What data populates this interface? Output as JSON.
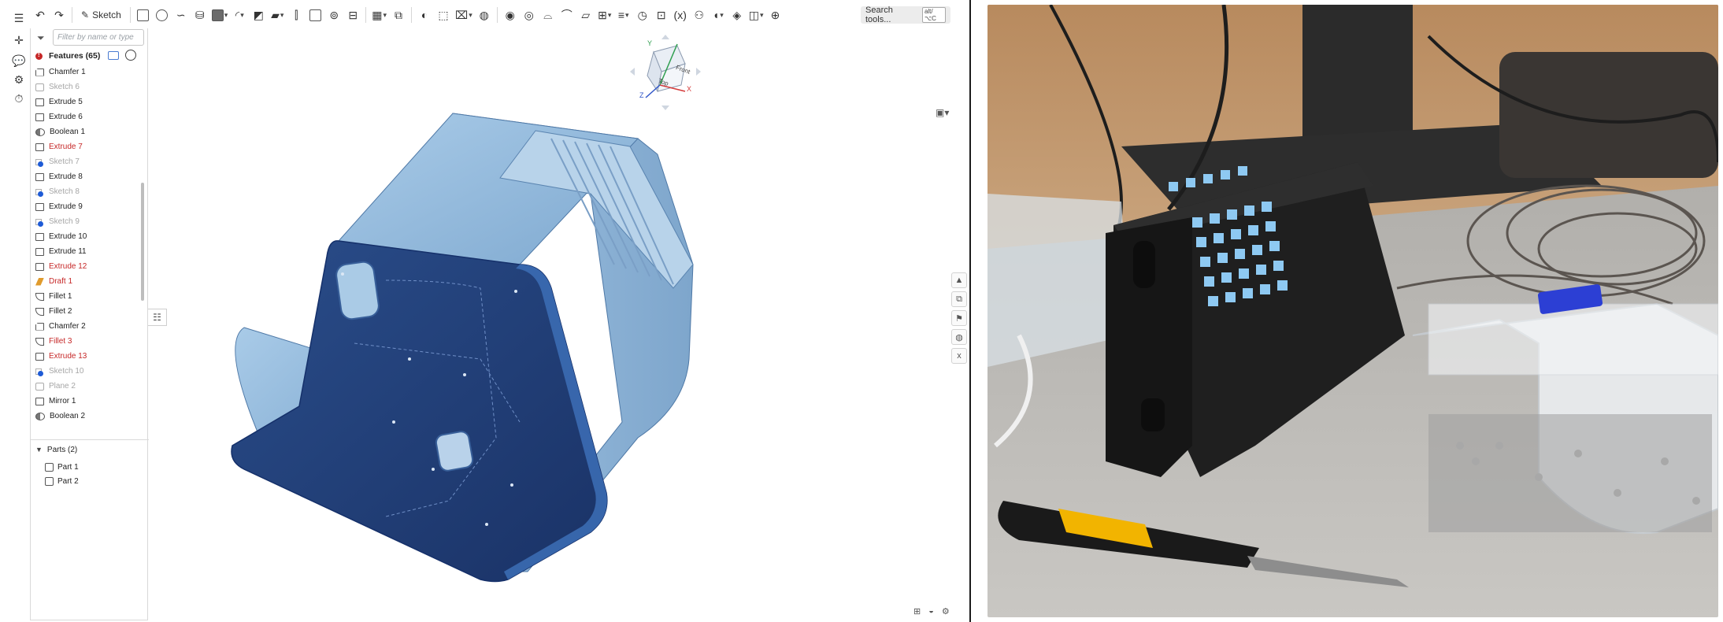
{
  "toolbar": {
    "sketch_label": "Sketch",
    "search_label": "Search tools...",
    "search_shortcut": "alt/⌥C"
  },
  "panel": {
    "filter_placeholder": "Filter by name or type",
    "features_title": "Features (65)",
    "features": [
      {
        "label": "Chamfer 1",
        "type": "cham",
        "state": "normal"
      },
      {
        "label": "Sketch 6",
        "type": "sketch",
        "state": "sketch"
      },
      {
        "label": "Extrude 5",
        "type": "extrude",
        "state": "normal"
      },
      {
        "label": "Extrude 6",
        "type": "extrude",
        "state": "normal"
      },
      {
        "label": "Boolean 1",
        "type": "bool",
        "state": "normal"
      },
      {
        "label": "Extrude 7",
        "type": "extrude",
        "state": "error"
      },
      {
        "label": "Sketch 7",
        "type": "sketch-blue",
        "state": "sketch"
      },
      {
        "label": "Extrude 8",
        "type": "extrude",
        "state": "normal"
      },
      {
        "label": "Sketch 8",
        "type": "sketch-blue",
        "state": "sketch"
      },
      {
        "label": "Extrude 9",
        "type": "extrude",
        "state": "normal"
      },
      {
        "label": "Sketch 9",
        "type": "sketch-blue",
        "state": "sketch"
      },
      {
        "label": "Extrude 10",
        "type": "extrude",
        "state": "normal"
      },
      {
        "label": "Extrude 11",
        "type": "extrude",
        "state": "normal"
      },
      {
        "label": "Extrude 12",
        "type": "extrude",
        "state": "error"
      },
      {
        "label": "Draft 1",
        "type": "draft",
        "state": "error"
      },
      {
        "label": "Fillet 1",
        "type": "fillet",
        "state": "normal"
      },
      {
        "label": "Fillet 2",
        "type": "fillet",
        "state": "normal"
      },
      {
        "label": "Chamfer 2",
        "type": "cham",
        "state": "normal"
      },
      {
        "label": "Fillet 3",
        "type": "fillet",
        "state": "error"
      },
      {
        "label": "Extrude 13",
        "type": "extrude",
        "state": "error"
      },
      {
        "label": "Sketch 10",
        "type": "sketch-blue",
        "state": "sketch"
      },
      {
        "label": "Plane 2",
        "type": "sketch",
        "state": "sketch"
      },
      {
        "label": "Mirror 1",
        "type": "extrude",
        "state": "normal"
      },
      {
        "label": "Boolean 2",
        "type": "bool",
        "state": "normal"
      }
    ],
    "parts_title": "Parts (2)",
    "parts": [
      "Part 1",
      "Part 2"
    ]
  },
  "viewcube": {
    "face_front": "Front",
    "face_top": "Top",
    "axis_x": "X",
    "axis_y": "Y",
    "axis_z": "Z"
  },
  "colors": {
    "error_red": "#c62828",
    "model_light_blue": "#8fb6d9",
    "model_dark_blue": "#1f3a72",
    "sketch_blue": "#1e5bd6"
  },
  "photo": {
    "description_icon": "photo-of-3d-printed-keypad-enclosure"
  }
}
